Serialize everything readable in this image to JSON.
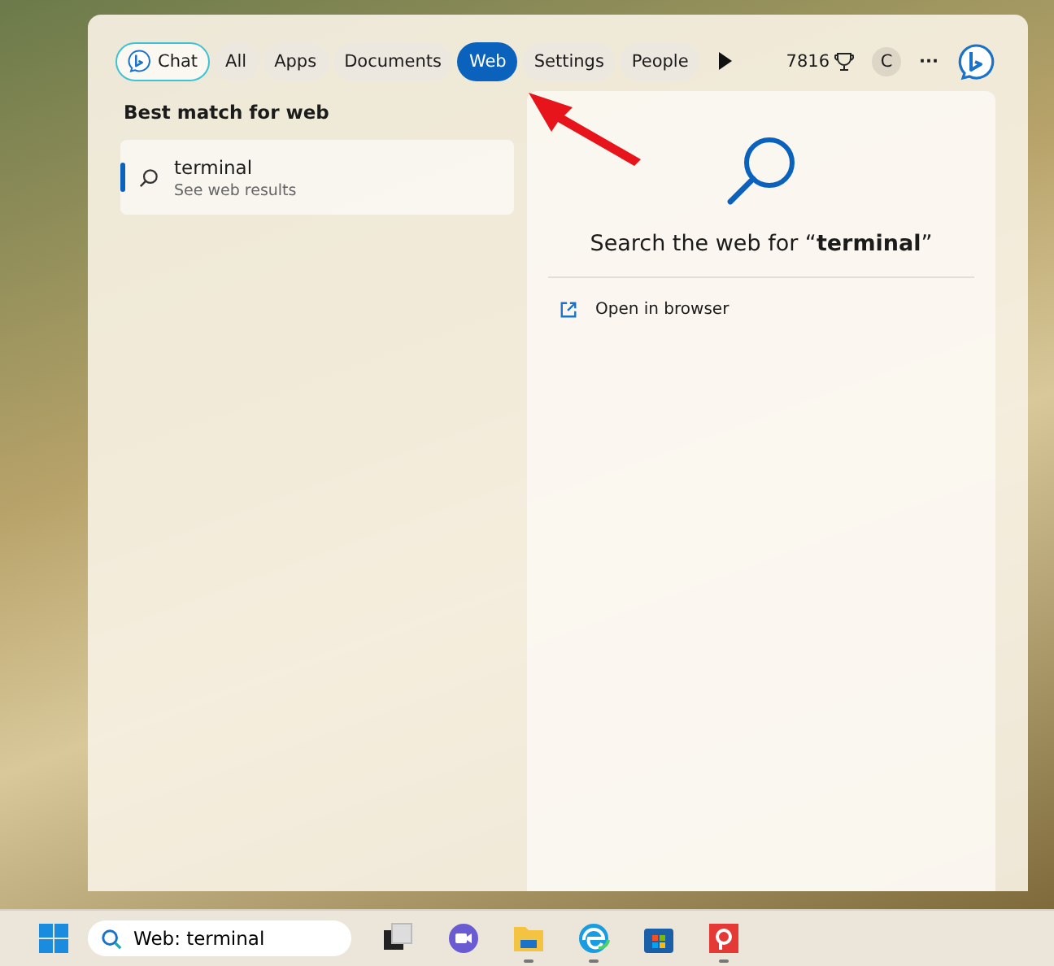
{
  "filters": [
    {
      "label": "Chat",
      "kind": "chat",
      "selected": false
    },
    {
      "label": "All",
      "kind": "filter",
      "selected": false
    },
    {
      "label": "Apps",
      "kind": "filter",
      "selected": false
    },
    {
      "label": "Documents",
      "kind": "filter",
      "selected": false
    },
    {
      "label": "Web",
      "kind": "filter",
      "selected": true
    },
    {
      "label": "Settings",
      "kind": "filter",
      "selected": false
    },
    {
      "label": "People",
      "kind": "filter",
      "selected": false
    }
  ],
  "rewards_points": "7816",
  "account_initial": "C",
  "more": "···",
  "best_match": {
    "heading": "Best match for web",
    "results": [
      {
        "title": "terminal",
        "subtitle": "See web results",
        "selected": true
      }
    ]
  },
  "preview": {
    "title": "Search the web for “**terminal**”",
    "actions": [
      "Open in browser"
    ]
  },
  "taskbar": {
    "search_value": "Web: terminal",
    "apps": [
      {
        "kind": "task-view",
        "running": false
      },
      {
        "kind": "chat",
        "running": false
      },
      {
        "kind": "explorer",
        "running": true
      },
      {
        "kind": "edge",
        "running": true
      },
      {
        "kind": "store",
        "running": false
      },
      {
        "kind": "red-app",
        "running": true
      }
    ]
  }
}
